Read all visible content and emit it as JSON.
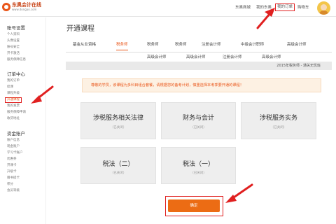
{
  "header": {
    "logo_name": "东奥会计在线",
    "logo_url": "www.dongao.com",
    "links": [
      {
        "label": "东奥商城"
      },
      {
        "label": "我的东奥"
      },
      {
        "label": "我的订单"
      },
      {
        "label": "购物车"
      }
    ],
    "active_link_index": 2
  },
  "sidebar": {
    "sections": [
      {
        "title": "账号设置",
        "items": [
          "个人资料",
          "头像设置",
          "账号安全",
          "开卡激活",
          "服务保障信息"
        ]
      },
      {
        "title": "订单中心",
        "items": [
          "我的订单",
          "续课",
          "课程升级",
          "开通课程",
          "我的发票",
          "服务保障申请",
          "收货地址"
        ]
      },
      {
        "title": "资金账户",
        "items": [
          "账户信息",
          "现金账户",
          "学习卡账户",
          "优惠券",
          "开课卡",
          "升级卡",
          "赠书提卡",
          "积分",
          "会员等级"
        ]
      }
    ],
    "active_item": "开通课程"
  },
  "main": {
    "title": "开通课程",
    "tabs": [
      "基金从业资格",
      "税务师",
      "税务师",
      "税务师",
      "注册会计师",
      "中级会计职称",
      "高级会计师"
    ],
    "active_tab_index": 1,
    "subtabs": [
      "高级会计师",
      "高级会计师",
      "注册会计师",
      "高级会计师"
    ],
    "banner_text": "2015年税务师 - 通关无忧班",
    "notice": "尊敬的学员，该课程为多科目组合套餐，请根据您的备考计划，慎重选择本考季要开通的课程！",
    "courses": [
      {
        "title": "涉税服务相关法律",
        "status": "（已关闭）"
      },
      {
        "title": "财务与会计",
        "status": "（已关闭）"
      },
      {
        "title": "涉税服务实务",
        "status": "（已关闭）"
      },
      {
        "title": "税法（二）",
        "status": "（已关闭）"
      },
      {
        "title": "税法（一）",
        "status": "（已关闭）"
      }
    ],
    "confirm_label": "确定"
  },
  "colors": {
    "accent": "#ec6c14",
    "annotation": "#e02020",
    "notice_bg": "#fdf1e3",
    "card_bg": "#eeeeee"
  }
}
